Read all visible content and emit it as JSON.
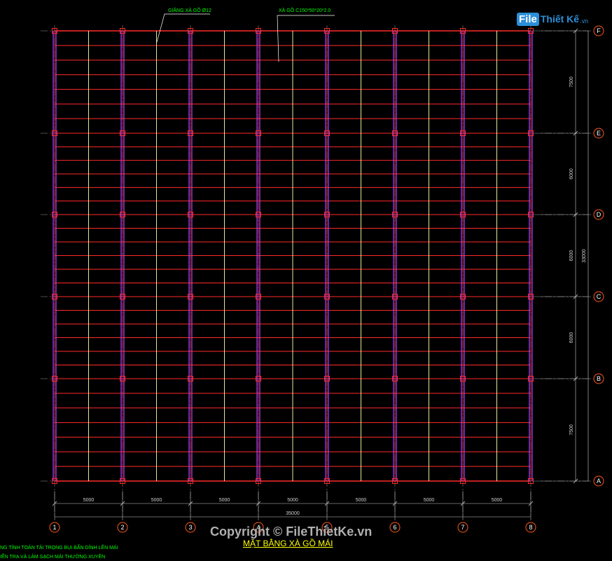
{
  "drawing": {
    "title": "MẶT BẰNG XÀ GỒ MÁI",
    "labels": {
      "bracing": "GIẰNG XÀ GỒ Ø12",
      "purlin": "XÀ GỒ C150*50*20*2.0"
    },
    "axes_x": [
      "1",
      "2",
      "3",
      "4",
      "5",
      "6",
      "7",
      "8"
    ],
    "axes_y": [
      "F",
      "E",
      "D",
      "C",
      "B",
      "A"
    ],
    "dims_x": [
      "5000",
      "5000",
      "5000",
      "5000",
      "5000",
      "5000",
      "5000"
    ],
    "total_x": "35000",
    "dims_y": [
      "7500",
      "6000",
      "6000",
      "6000",
      "7500"
    ],
    "total_y": "33000",
    "notes": [
      "NG TÍNH TOÁN TẢI TRỌNG BỤI BẨN DÍNH LÊN MÁI",
      "IỂN TRA VÀ LÀM SẠCH MÁI THƯỜNG XUYÊN"
    ]
  },
  "logo": {
    "part1": "File",
    "part2": "Thiết Kế",
    "part3": ".vn"
  },
  "copyright": "Copyright © FileThietKe.vn",
  "colors": {
    "purlin": "#ff2a2a",
    "frame": "#b040ff",
    "sagrod": "#ffffaa",
    "axis": "#ff5a1a",
    "annotation": "#00ff00",
    "dimension": "#cfcfcf"
  }
}
